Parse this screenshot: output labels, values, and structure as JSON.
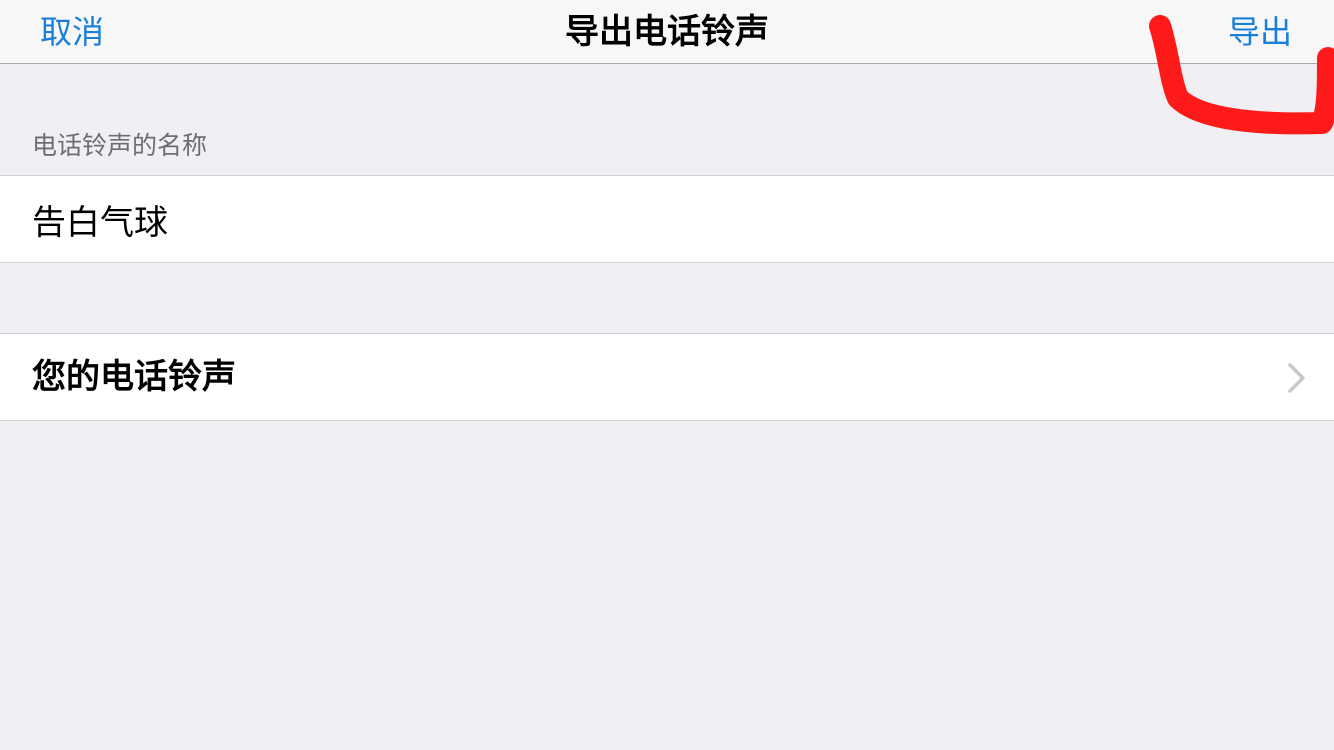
{
  "navbar": {
    "cancel_label": "取消",
    "title": "导出电话铃声",
    "export_label": "导出"
  },
  "form": {
    "section_header": "电话铃声的名称",
    "ringtone_name_value": "告白气球",
    "your_ringtones_label": "您的电话铃声"
  },
  "icons": {
    "disclosure": "chevron-right-icon"
  },
  "colors": {
    "accent": "#1a7fd9",
    "background": "#efeff4",
    "annotation": "#ff1a1a"
  }
}
